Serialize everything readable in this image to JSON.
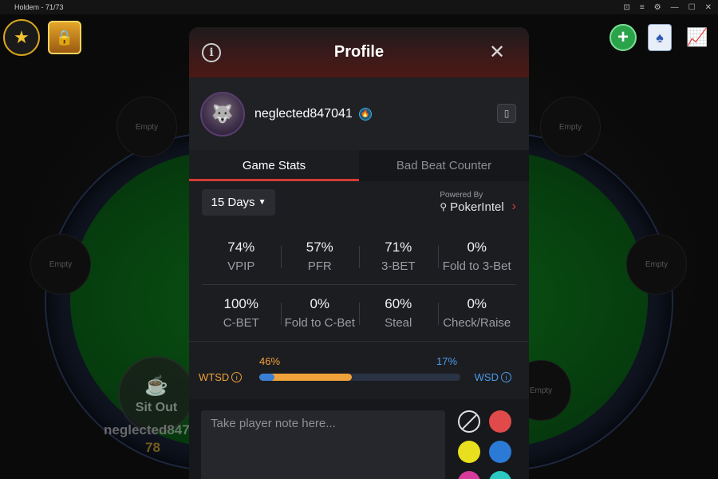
{
  "window": {
    "title": "Holdem - 71/73",
    "controls": [
      "⊡",
      "≡",
      "⚙",
      "—",
      "☐",
      "✕"
    ]
  },
  "table": {
    "empty_seat_label": "Empty",
    "player": {
      "status": "Sit Out",
      "name": "neglected847041",
      "stack": "78"
    }
  },
  "hud": {
    "left_icons": [
      "star-rank-icon",
      "treasure-chest-icon"
    ],
    "right_icons": [
      "add-chips-icon",
      "cards-icon",
      "stats-chart-icon"
    ]
  },
  "profile": {
    "title": "Profile",
    "username": "neglected847041",
    "tabs": [
      {
        "label": "Game Stats",
        "active": true
      },
      {
        "label": "Bad Beat Counter",
        "active": false
      }
    ],
    "period": {
      "selected": "15 Days"
    },
    "powered_by": {
      "label": "Powered By",
      "brand": "PokerIntel"
    },
    "stats_row1": [
      {
        "value": "74%",
        "label": "VPIP"
      },
      {
        "value": "57%",
        "label": "PFR"
      },
      {
        "value": "71%",
        "label": "3-BET"
      },
      {
        "value": "0%",
        "label": "Fold to 3-Bet"
      }
    ],
    "stats_row2": [
      {
        "value": "100%",
        "label": "C-BET"
      },
      {
        "value": "0%",
        "label": "Fold to C-Bet"
      },
      {
        "value": "60%",
        "label": "Steal"
      },
      {
        "value": "0%",
        "label": "Check/Raise"
      }
    ],
    "showdown": {
      "wtsd_label": "WTSD",
      "wsd_label": "WSD",
      "wtsd_value": "46%",
      "wsd_value": "17%",
      "wtsd_fraction": 0.46,
      "wsd_fraction": 0.17
    },
    "note": {
      "placeholder": "Take player note here...",
      "value": ""
    },
    "note_colors": [
      "none",
      "#e04a4a",
      "#e8e01e",
      "#2a7ad6",
      "#d63a9a",
      "#2ac8c0"
    ]
  }
}
